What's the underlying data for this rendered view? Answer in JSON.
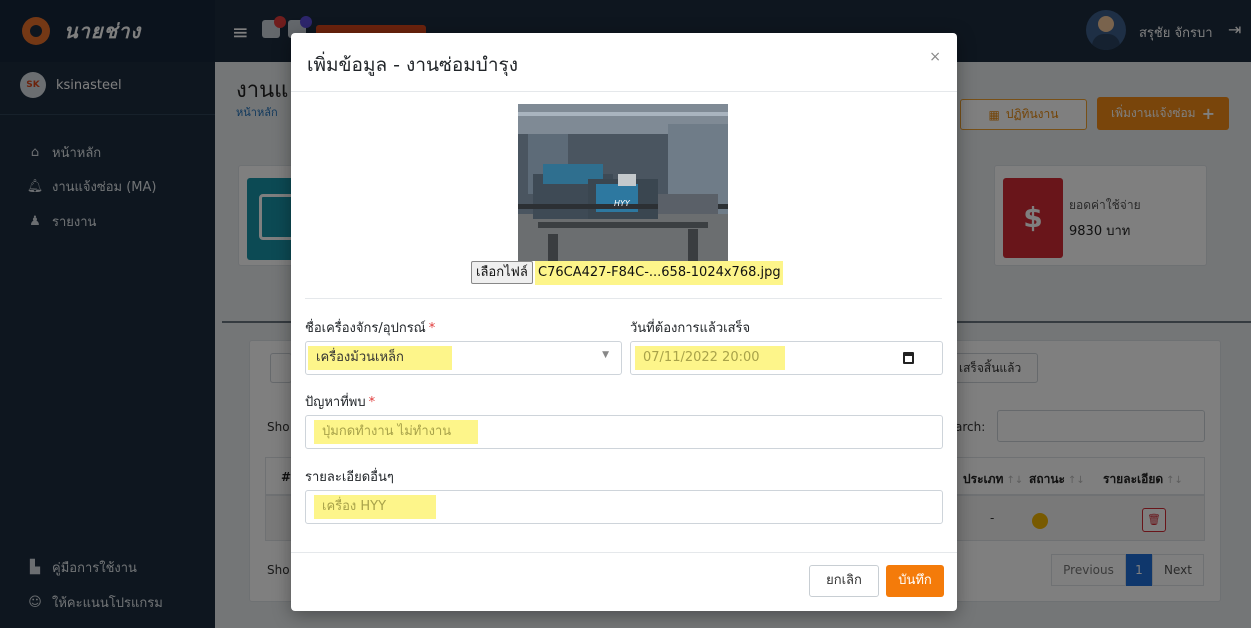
{
  "app": {
    "brand_name": "นายช่าง",
    "user_name": "สรุชัย จักรบา"
  },
  "sidebar": {
    "company_logo_text": "SK",
    "company_name": "ksinasteel",
    "items": [
      {
        "label": "หน้าหลัก",
        "icon": "home-icon"
      },
      {
        "label": "งานแจ้งซ่อม (MA)",
        "icon": "bell-icon"
      },
      {
        "label": "รายงาน",
        "icon": "users-cog-icon"
      }
    ],
    "bottom_items": [
      {
        "label": "คู่มือการใช้งาน",
        "icon": "manual-icon"
      },
      {
        "label": "ให้คะแนนโปรแกรม",
        "icon": "smile-icon"
      }
    ]
  },
  "page": {
    "title": "งานแ",
    "breadcrumb": "หน้าหลัก",
    "calendar_button": "ปฏิทินงาน",
    "add_button": "เพิ่มงานแจ้งซ่อม",
    "cost_label": "ยอดค่าใช้จ่าย",
    "cost_value": "9830 บาท",
    "tab_done": "เสร็จสิ้นแล้ว",
    "show_top": "Sho",
    "show_bottom": "Sho",
    "search_label": "arch:",
    "table": {
      "headers": [
        "#",
        "ประเภท",
        "สถานะ",
        "รายละเอียด"
      ],
      "row": {
        "type": "-",
        "status_color": "#f0b400"
      }
    },
    "pagination": {
      "previous": "Previous",
      "current": "1",
      "next": "Next"
    }
  },
  "modal": {
    "title": "เพิ่มข้อมูล - งานซ่อมบำรุง",
    "close_symbol": "×",
    "file_button": "เลือกไฟล์",
    "file_name": "C76CA427-F84C-...658-1024x768.jpg",
    "photo_brand": "HYY",
    "fields": {
      "machine_label": "ชื่อเครื่องจักร/อุปกรณ์",
      "machine_value": "เครื่องม้วนเหล็ก",
      "due_label": "วันที่ต้องการแล้วเสร็จ",
      "due_value": "07/11/2022 20:00",
      "problem_label": "ปัญหาที่พบ",
      "problem_value": "ปุ่มกดทำงาน ไม่ทำงาน",
      "details_label": "รายละเอียดอื่นๆ",
      "details_value": "เครื่อง HYY"
    },
    "required_mark": "*",
    "cancel_button": "ยกเลิก",
    "save_button": "บันทึก"
  },
  "colors": {
    "accent": "#f28a16",
    "highlight": "#fdf58a",
    "sidebar": "#1c2d3f"
  }
}
